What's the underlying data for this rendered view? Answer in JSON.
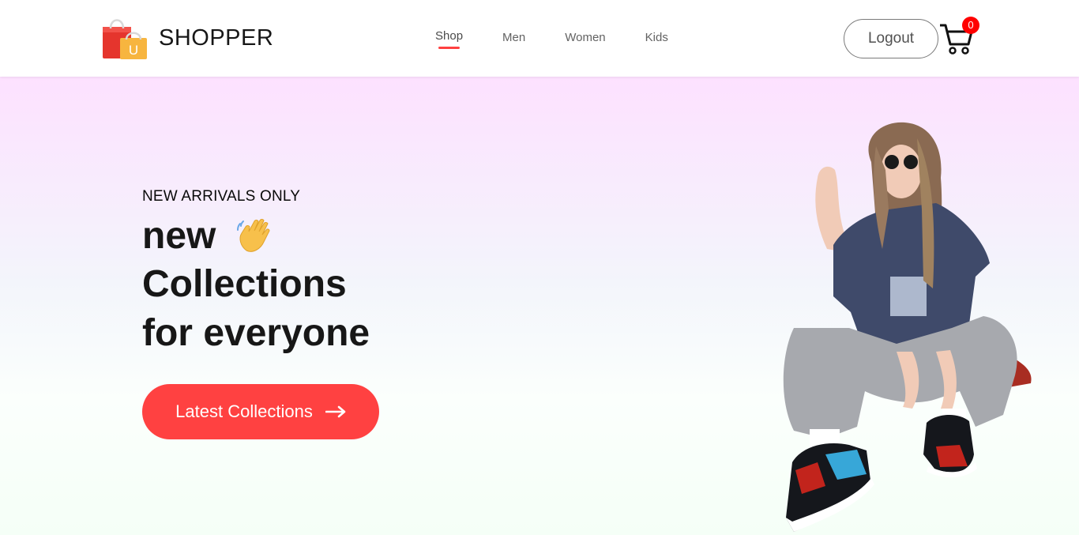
{
  "brand": {
    "name": "SHOPPER",
    "bag_letter": "U"
  },
  "nav": {
    "items": [
      {
        "label": "Shop",
        "active": true
      },
      {
        "label": "Men",
        "active": false
      },
      {
        "label": "Women",
        "active": false
      },
      {
        "label": "Kids",
        "active": false
      }
    ],
    "logout_label": "Logout",
    "cart_count": "0"
  },
  "hero": {
    "subtitle": "NEW ARRIVALS ONLY",
    "line1": "new",
    "line2": "Collections",
    "line3": "for everyone",
    "cta_label": "Latest Collections"
  },
  "icons": {
    "logo": "shopping-bag-icon",
    "wave": "waving-hand-icon",
    "cart": "cart-icon",
    "arrow": "arrow-right-icon"
  },
  "colors": {
    "accent": "#ff4141",
    "cart_badge": "#ff0000",
    "hero_top": "#fde1ff",
    "hero_bottom": "#f5fff7"
  }
}
